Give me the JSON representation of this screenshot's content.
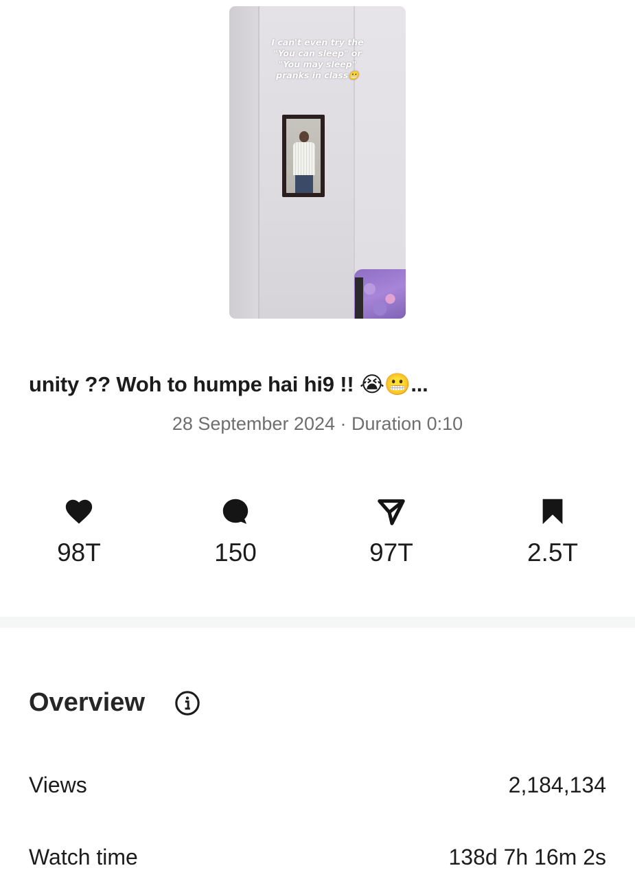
{
  "thumbnail": {
    "caption": "I can't even try the\n\"You can sleep\" or\n\"You may sleep\"\npranks in class😬"
  },
  "post": {
    "title": "unity ?? Woh to humpe hai hi9 !! 😭😬...",
    "date": "28 September 2024",
    "separator": "·",
    "duration": "Duration 0:10"
  },
  "stats": {
    "likes": {
      "icon": "heart-icon",
      "value": "98T"
    },
    "comments": {
      "icon": "comment-icon",
      "value": "150"
    },
    "shares": {
      "icon": "send-icon",
      "value": "97T"
    },
    "saves": {
      "icon": "bookmark-icon",
      "value": "2.5T"
    }
  },
  "overview": {
    "heading": "Overview",
    "info_icon": "info-icon",
    "rows": [
      {
        "label": "Views",
        "value": "2,184,134"
      },
      {
        "label": "Watch time",
        "value": "138d 7h 16m 2s"
      }
    ]
  },
  "colors": {
    "text_primary": "#1c1c1c",
    "text_secondary": "#6e6e6e",
    "divider": "#f5f6f6"
  }
}
